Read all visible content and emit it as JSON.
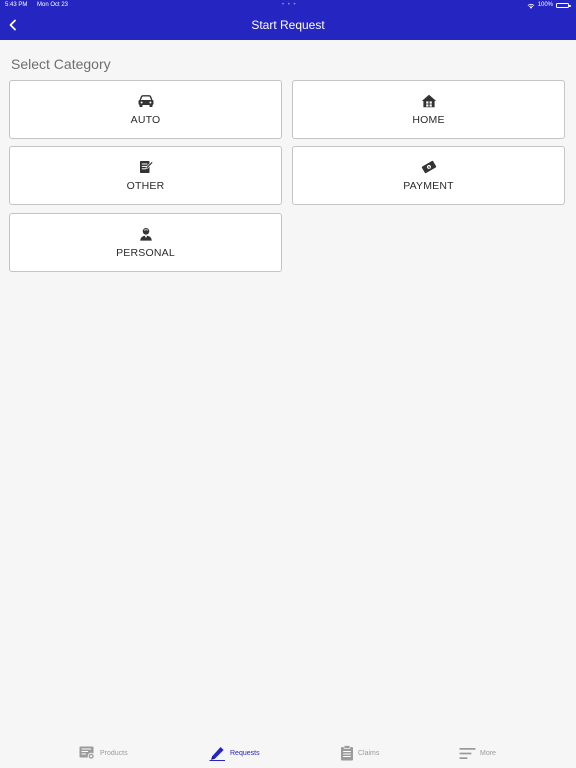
{
  "status_bar": {
    "time": "5:43 PM",
    "date": "Mon Oct 23",
    "dots": "• • •",
    "battery": "100%"
  },
  "nav": {
    "title": "Start Request",
    "back_icon": "chevron-left-icon"
  },
  "section_title": "Select Category",
  "categories": [
    {
      "label": "AUTO",
      "icon": "car-icon"
    },
    {
      "label": "HOME",
      "icon": "house-icon"
    },
    {
      "label": "OTHER",
      "icon": "document-edit-icon"
    },
    {
      "label": "PAYMENT",
      "icon": "payment-icon"
    },
    {
      "label": "PERSONAL",
      "icon": "person-icon"
    }
  ],
  "tabs": [
    {
      "label": "Products",
      "icon": "products-icon",
      "active": false
    },
    {
      "label": "Requests",
      "icon": "pencil-icon",
      "active": true
    },
    {
      "label": "Claims",
      "icon": "clipboard-icon",
      "active": false
    },
    {
      "label": "More",
      "icon": "menu-lines-icon",
      "active": false
    }
  ],
  "colors": {
    "primary": "#2525c2",
    "background": "#f6f6f6",
    "card_border": "#c4c4c4",
    "inactive_tab": "#9b9b9b"
  }
}
